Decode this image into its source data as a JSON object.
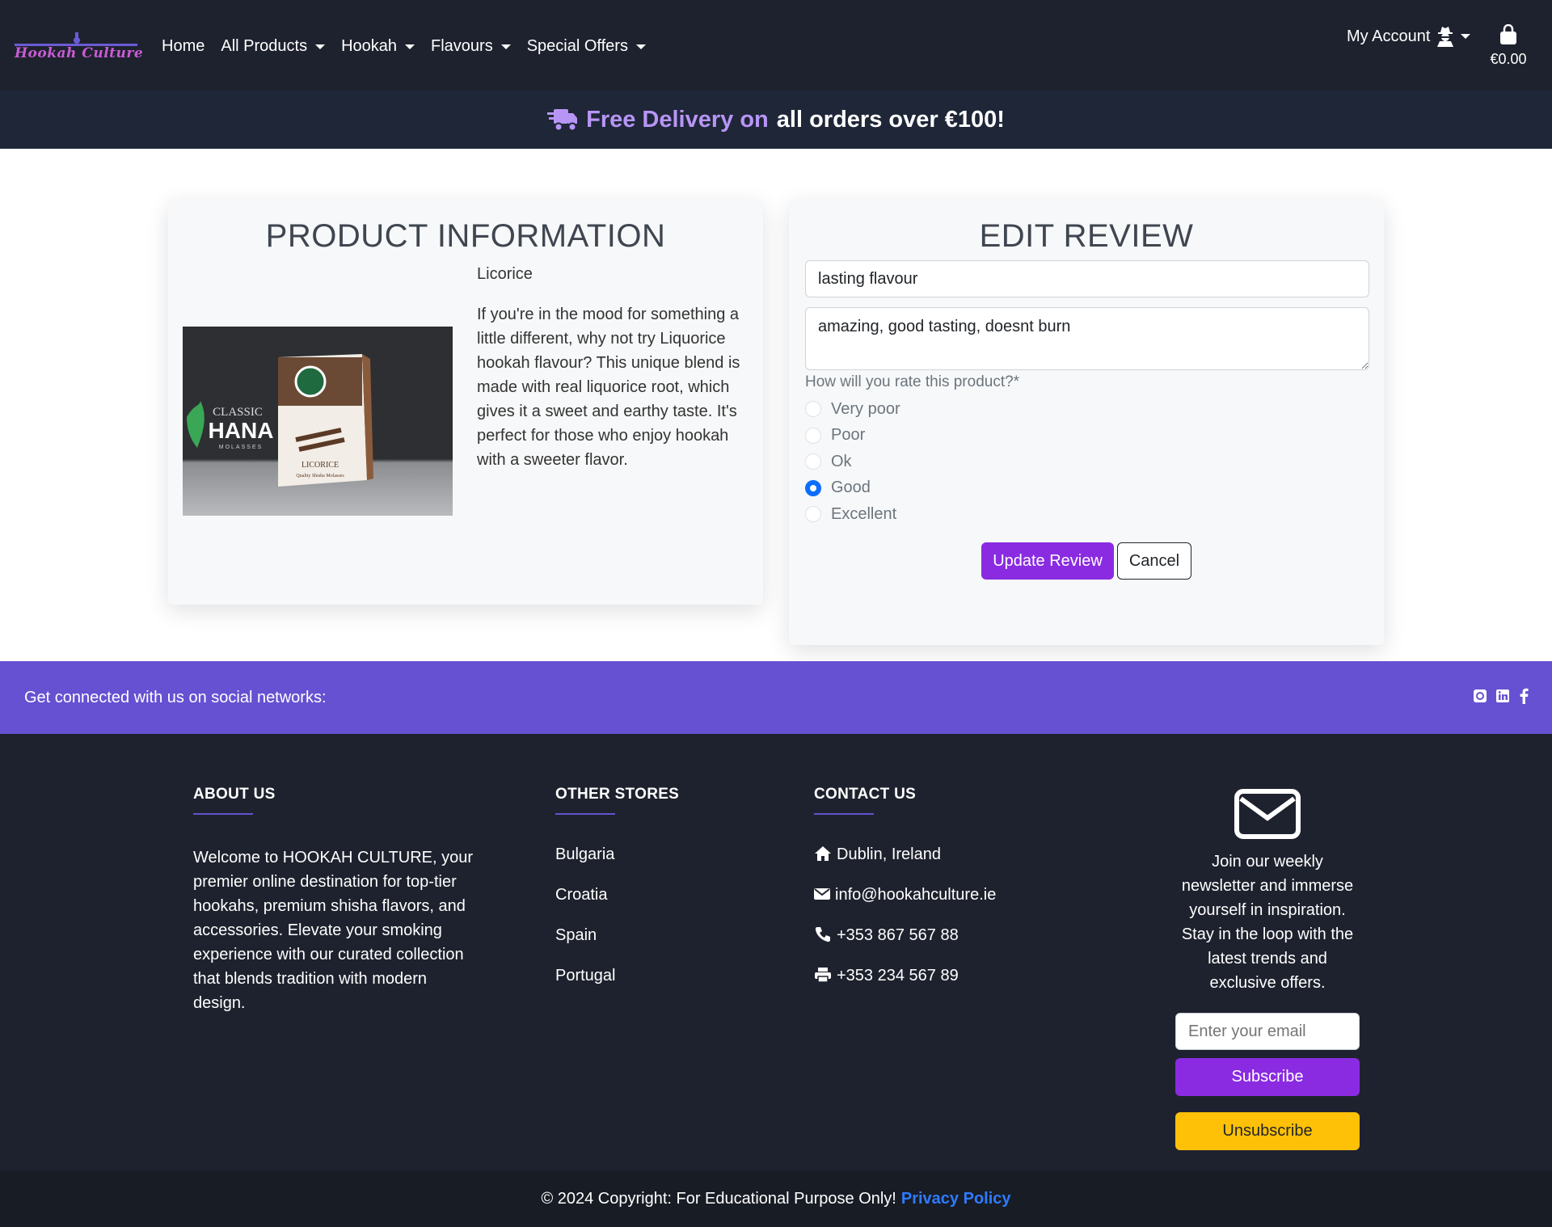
{
  "brand": {
    "logo_text": "Hookah Culture"
  },
  "nav": {
    "links": [
      {
        "label": "Home",
        "dropdown": false
      },
      {
        "label": "All Products",
        "dropdown": true
      },
      {
        "label": "Hookah",
        "dropdown": true
      },
      {
        "label": "Flavours",
        "dropdown": true
      },
      {
        "label": "Special Offers",
        "dropdown": true
      }
    ],
    "account_label": "My Account",
    "cart_total": "€0.00"
  },
  "banner": {
    "accent": "Free Delivery on",
    "rest": "all orders over €100!"
  },
  "product": {
    "heading": "PRODUCT INFORMATION",
    "name": "Licorice",
    "description": "If you're in the mood for something a little different, why not try Liquorice hookah flavour? This unique blend is made with real liquorice root, which gives it a sweet and earthy taste. It's perfect for those who enjoy hookah with a sweeter flavor.",
    "image_text": {
      "line1": "CLASSIC",
      "line2": "HANA",
      "line3": "MOLASSES",
      "box_label": "LICORICE",
      "box_sub": "Quality Shisha Molasses"
    }
  },
  "review": {
    "heading": "EDIT REVIEW",
    "title_value": "lasting flavour",
    "body_value": "amazing, good tasting, doesnt burn",
    "rating_label": "How will you rate this product?*",
    "ratings": [
      "Very poor",
      "Poor",
      "Ok",
      "Good",
      "Excellent"
    ],
    "selected_rating": "Good",
    "update_label": "Update Review",
    "cancel_label": "Cancel"
  },
  "social": {
    "text": "Get connected with us on social networks:",
    "icons": [
      "github-icon",
      "linkedin-icon",
      "facebook-icon"
    ]
  },
  "footer": {
    "about": {
      "heading": "ABOUT US",
      "text": "Welcome to HOOKAH CULTURE, your premier online destination for top-tier hookahs, premium shisha flavors, and accessories. Elevate your smoking experience with our curated collection that blends tradition with modern design."
    },
    "stores": {
      "heading": "OTHER STORES",
      "items": [
        "Bulgaria",
        "Croatia",
        "Spain",
        "Portugal"
      ]
    },
    "contact": {
      "heading": "CONTACT US",
      "items": [
        {
          "icon": "home-icon",
          "text": "Dublin, Ireland"
        },
        {
          "icon": "envelope-icon",
          "text": "info@hookahculture.ie"
        },
        {
          "icon": "phone-icon",
          "text": "+353 867 567 88"
        },
        {
          "icon": "printer-icon",
          "text": "+353 234 567 89"
        }
      ]
    },
    "newsletter": {
      "text": "Join our weekly newsletter and immerse yourself in inspiration. Stay in the loop with the latest trends and exclusive offers.",
      "placeholder": "Enter your email",
      "subscribe_label": "Subscribe",
      "unsubscribe_label": "Unsubscribe"
    }
  },
  "copyright": {
    "text": "© 2024 Copyright: For Educational Purpose Only!",
    "link": "Privacy Policy"
  },
  "colors": {
    "purple": "#8a2be2",
    "social_bar": "#6551d2",
    "nav_bg": "#1e222e",
    "accent_text": "#b795f5",
    "warning": "#ffc107",
    "link_blue": "#2f7bff"
  }
}
